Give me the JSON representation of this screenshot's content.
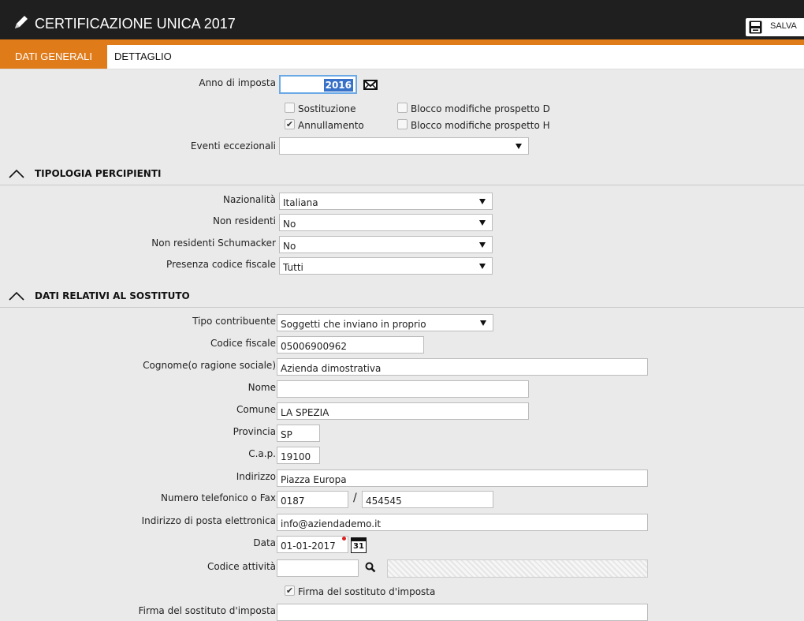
{
  "header": {
    "title": "CERTIFICAZIONE UNICA 2017",
    "save_label": "SALVA",
    "accent_color": "#e07b1a",
    "bar_color": "#1f1f1f"
  },
  "tabs": [
    {
      "label": "DATI GENERALI",
      "active": true
    },
    {
      "label": "DETTAGLIO",
      "active": false
    }
  ],
  "general": {
    "anno_label": "Anno di imposta",
    "anno_value": "2016",
    "checkboxes": [
      {
        "label": "Sostituzione",
        "checked": false
      },
      {
        "label": "Blocco modifiche prospetto D",
        "checked": false
      },
      {
        "label": "Annullamento",
        "checked": true
      },
      {
        "label": "Blocco modifiche prospetto H",
        "checked": false
      }
    ],
    "eventi_label": "Eventi eccezionali",
    "eventi_value": ""
  },
  "tipologia": {
    "title": "TIPOLOGIA PERCIPIENTI",
    "nazionalita_label": "Nazionalità",
    "nazionalita_value": "Italiana",
    "non_residenti_label": "Non residenti",
    "non_residenti_value": "No",
    "schumacker_label": "Non residenti Schumacker",
    "schumacker_value": "No",
    "cf_label": "Presenza codice fiscale",
    "cf_value": "Tutti"
  },
  "sostituto": {
    "title": "DATI RELATIVI AL SOSTITUTO",
    "tipo_label": "Tipo contribuente",
    "tipo_value": "Soggetti che inviano in proprio",
    "cf_label": "Codice fiscale",
    "cf_value": "05006900962",
    "cognome_label": "Cognome(o ragione sociale)",
    "cognome_value": "Azienda dimostrativa",
    "nome_label": "Nome",
    "nome_value": "",
    "comune_label": "Comune",
    "comune_value": "LA SPEZIA",
    "provincia_label": "Provincia",
    "provincia_value": "SP",
    "cap_label": "C.a.p.",
    "cap_value": "19100",
    "indirizzo_label": "Indirizzo",
    "indirizzo_value": "Piazza Europa",
    "telefono_label": "Numero telefonico o Fax",
    "telefono_prefix": "0187",
    "telefono_slash": "/",
    "telefono_number": "454545",
    "email_label": "Indirizzo di posta elettronica",
    "email_value": "info@aziendademo.it",
    "data_label": "Data",
    "data_value": "01-01-2017",
    "calendar_day": "31",
    "attivita_label": "Codice attività",
    "attivita_value": "",
    "firma_check_label": "Firma del sostituto d'imposta",
    "firma_check_checked": true,
    "firma_label": "Firma del sostituto d'imposta",
    "firma_value": ""
  }
}
